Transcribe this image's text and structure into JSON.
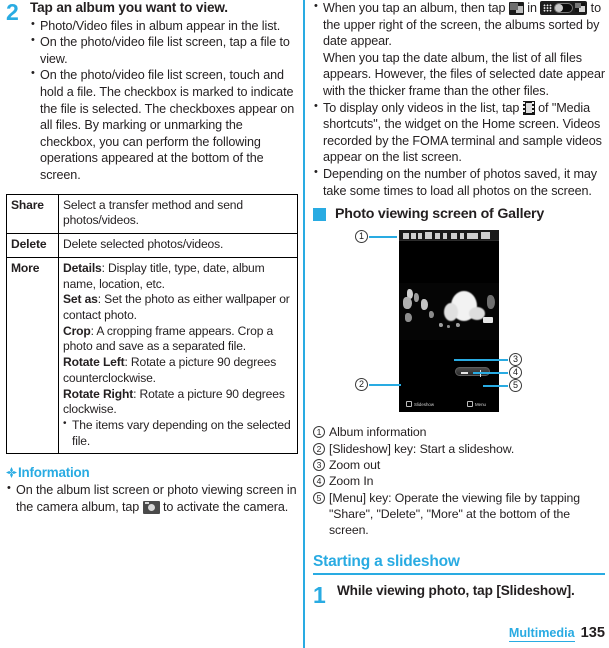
{
  "document": {
    "page_number": "135",
    "chapter": "Multimedia"
  },
  "left_column": {
    "step": {
      "number": "2",
      "title": "Tap an album you want to view.",
      "bullets": [
        "Photo/Video files in album appear in the list.",
        "On the photo/video file list screen, tap a file to view.",
        "On the photo/video file list screen, touch and hold a file. The checkbox is marked to indicate the file is selected. The checkboxes appear on all files. By marking or unmarking the checkbox, you can perform the following operations appeared at the bottom of the screen."
      ]
    },
    "options_table": {
      "rows": [
        {
          "key": "Share",
          "value": "Select a transfer method and send photos/videos."
        },
        {
          "key": "Delete",
          "value": "Delete selected photos/videos."
        },
        {
          "key": "More",
          "entries": [
            {
              "term": "Details",
              "desc": ": Display title, type, date, album name, location, etc."
            },
            {
              "term": "Set as",
              "desc": ": Set the photo as either wallpaper or contact photo."
            },
            {
              "term": "Crop",
              "desc": ": A cropping frame appears. Crop a photo and save as a separated file."
            },
            {
              "term": "Rotate Left",
              "desc": ": Rotate a picture 90 degrees counterclockwise."
            },
            {
              "term": "Rotate Right",
              "desc": ": Rotate a picture 90 degrees clockwise."
            }
          ],
          "note": "The items vary depending on the selected file."
        }
      ]
    },
    "information": {
      "heading": "Information",
      "icon": "diamond-flower-icon",
      "bullets": [
        {
          "pre": "On the album list screen or photo viewing screen in the camera album, tap",
          "icon": "camera-icon",
          "post": "to activate the camera."
        }
      ]
    }
  },
  "right_column": {
    "bullets": [
      {
        "parts": [
          {
            "t": "text",
            "v": "When you tap an album, then tap"
          },
          {
            "t": "icon",
            "v": "gallery-grid-icon"
          },
          {
            "t": "text",
            "v": "in"
          },
          {
            "t": "icon",
            "v": "view-toggle-icon"
          },
          {
            "t": "text",
            "v": "to the upper right of the screen, the albums sorted by date appear."
          }
        ],
        "continuation": "When you tap the date album, the list of all files appears. However, the files of selected date appear with the thicker frame than the other files."
      },
      {
        "parts": [
          {
            "t": "text",
            "v": "To display only videos in the list, tap"
          },
          {
            "t": "icon",
            "v": "film-strip-icon"
          },
          {
            "t": "text",
            "v": "of \"Media shortcuts\", the widget on the Home screen. Videos recorded by the FOMA terminal and sample videos appear on the list screen."
          }
        ]
      },
      {
        "parts": [
          {
            "t": "text",
            "v": "Depending on the number of photos saved, it may take some times to load all photos on the screen."
          }
        ]
      }
    ],
    "section_heading": "Photo viewing screen of Gallery",
    "figure": {
      "callouts": [
        "1",
        "2",
        "3",
        "4",
        "5"
      ],
      "phone_screen": {
        "slideshow_label": "Slideshow",
        "menu_label": "Menu"
      }
    },
    "legend": [
      {
        "num": "1",
        "text": "Album information"
      },
      {
        "num": "2",
        "text": "[Slideshow] key: Start a slideshow."
      },
      {
        "num": "3",
        "text": "Zoom out"
      },
      {
        "num": "4",
        "text": "Zoom In"
      },
      {
        "num": "5",
        "text": "[Menu] key: Operate the viewing file by tapping \"Share\", \"Delete\", \"More\" at the bottom of the screen."
      }
    ],
    "slideshow_section": {
      "heading": "Starting a slideshow",
      "step": {
        "number": "1",
        "title": "While viewing photo, tap [Slideshow]."
      }
    }
  },
  "colors": {
    "accent": "#29abe2",
    "text": "#231f20",
    "rule": "#000000"
  }
}
